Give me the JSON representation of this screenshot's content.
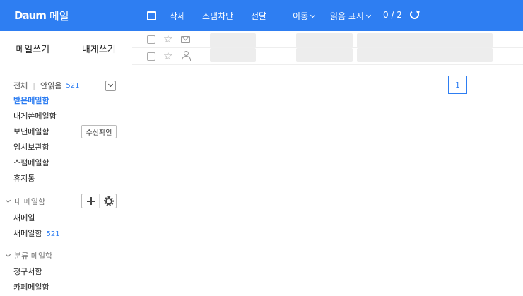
{
  "app": {
    "logo_text": "Daum",
    "logo_suffix": "메일"
  },
  "toolbar": {
    "delete_label": "삭제",
    "block_spam_label": "스팸차단",
    "forward_label": "전달",
    "move_label": "이동",
    "read_status_label": "읽음 표시",
    "count_text": "0 / 2"
  },
  "sidebar": {
    "write_mail_label": "메일쓰기",
    "write_to_me_label": "내게쓰기",
    "all_label": "전체",
    "unread_label": "안읽음",
    "unread_count": "521",
    "folders": [
      {
        "label": "받은메일함"
      },
      {
        "label": "내게쓴메일함"
      },
      {
        "label": "보낸메일함"
      },
      {
        "label": "임시보관함"
      },
      {
        "label": "스팸메일함"
      },
      {
        "label": "휴지통"
      }
    ],
    "receipt_button_label": "수신확인",
    "my_mailbox_section": "내 메일함",
    "my_folders": [
      {
        "label": "새메일",
        "count": ""
      },
      {
        "label": "새메일함",
        "count": "521"
      }
    ],
    "category_section": "분류 메일함",
    "category_folders": [
      {
        "label": "청구서함"
      },
      {
        "label": "카페메일함"
      }
    ]
  },
  "pagination": {
    "current_page": "1"
  },
  "colors": {
    "header": "#2e7ef2",
    "accent": "#2e7ef2"
  },
  "icons": [
    "checkbox-icon",
    "refresh-icon",
    "star-icon",
    "envelope-icon",
    "person-icon",
    "plus-icon",
    "gear-icon",
    "chevron-down-icon"
  ]
}
